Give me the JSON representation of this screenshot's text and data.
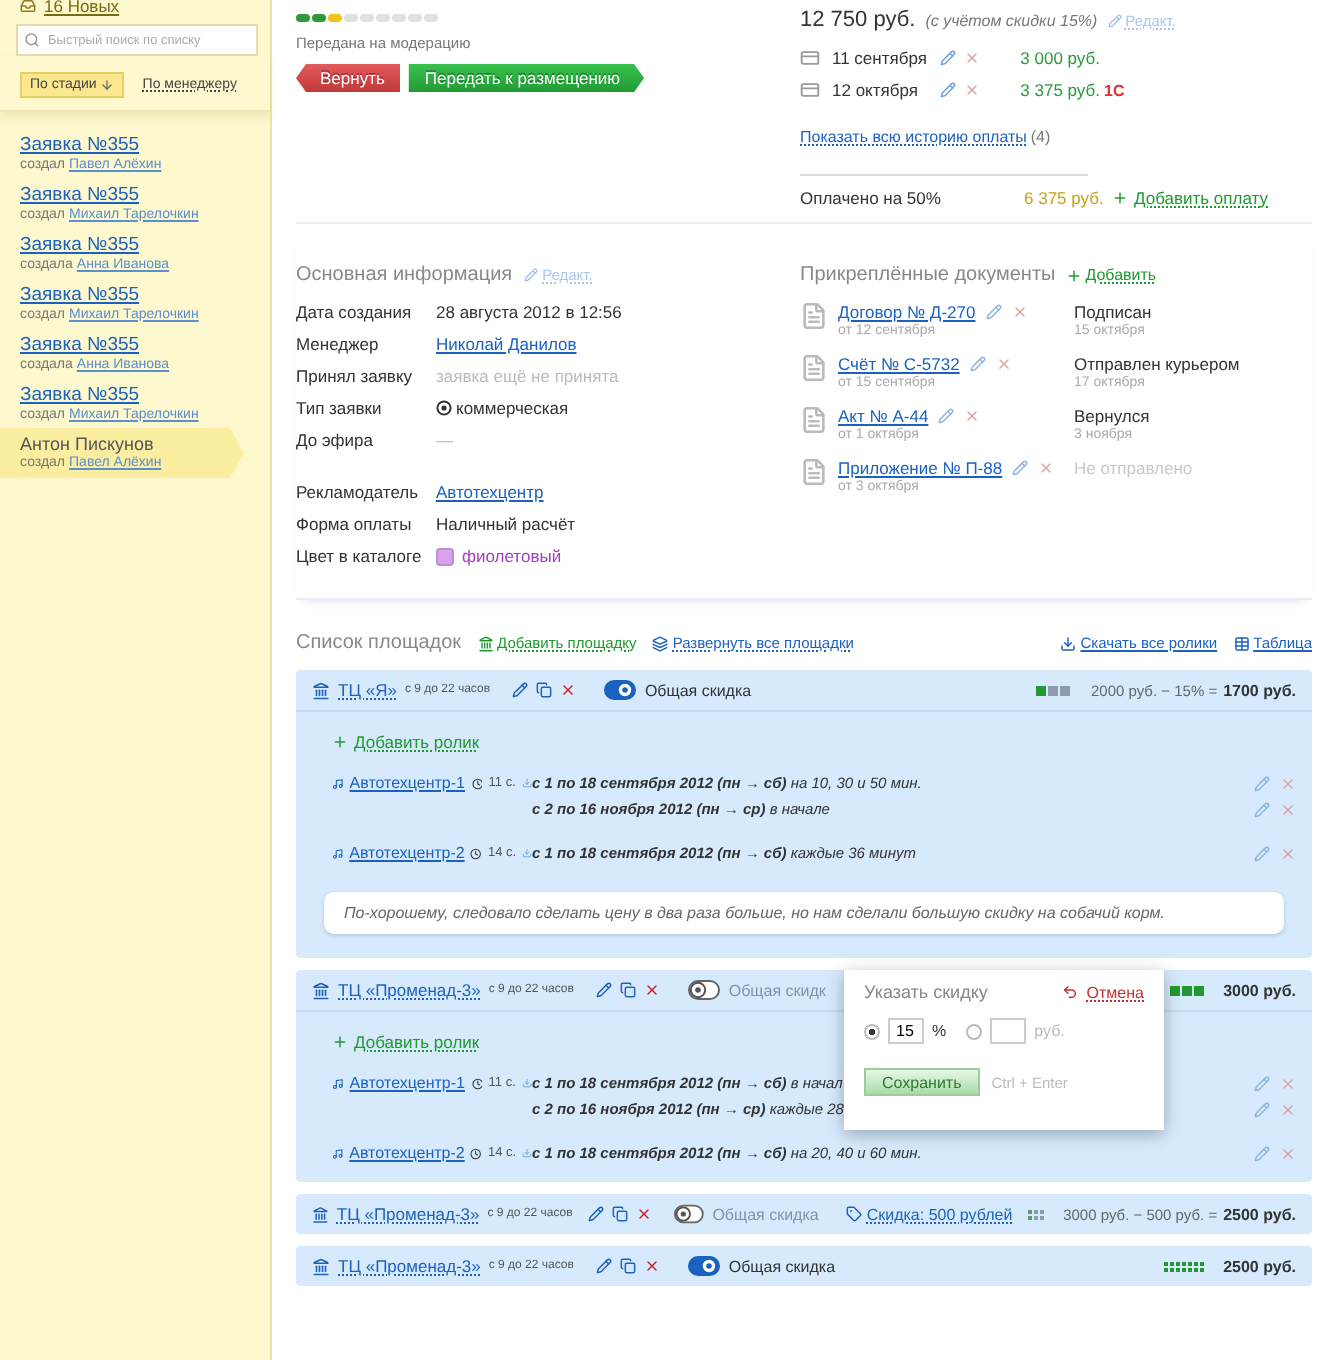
{
  "sidebar": {
    "new_link": "16 Новых",
    "search": {
      "placeholder": "Быстрый поиск по списку"
    },
    "sort_tabs": [
      {
        "label": "По стадии",
        "selected": true
      },
      {
        "label": "По менеджеру",
        "selected": false
      }
    ],
    "items": [
      {
        "title": "Заявка №355",
        "prefix": "создал",
        "author": "Павел Алёхин",
        "selected": false
      },
      {
        "title": "Заявка №355",
        "prefix": "создал",
        "author": "Михаил Тарелочкин",
        "selected": false
      },
      {
        "title": "Заявка №355",
        "prefix": "создала",
        "author": "Анна Иванова",
        "selected": false
      },
      {
        "title": "Заявка №355",
        "prefix": "создал",
        "author": "Михаил Тарелочкин",
        "selected": false
      },
      {
        "title": "Заявка №355",
        "prefix": "создала",
        "author": "Анна Иванова",
        "selected": false
      },
      {
        "title": "Заявка №355",
        "prefix": "создал",
        "author": "Михаил Тарелочкин",
        "selected": false
      },
      {
        "title": "Антон Пискунов",
        "prefix": "создал",
        "author": "Павел Алёхин",
        "selected": true
      }
    ]
  },
  "stage": {
    "segments": [
      {
        "color": "#2f9a3c"
      },
      {
        "color": "#2f9a3c"
      },
      {
        "color": "#f2c318"
      },
      {
        "color": "#e0e0e0"
      },
      {
        "color": "#e0e0e0"
      },
      {
        "color": "#e0e0e0"
      },
      {
        "color": "#e0e0e0"
      },
      {
        "color": "#e0e0e0"
      },
      {
        "color": "#e0e0e0"
      }
    ],
    "label": "Передана на модерацию",
    "buttons": [
      {
        "label": "Вернуть",
        "kind": "back"
      },
      {
        "label": "Передать к размещению",
        "kind": "forward"
      }
    ]
  },
  "payment": {
    "total": "12 750 руб.",
    "note": "(с учётом скидки 15%)",
    "edit": "Редакт.",
    "rows": [
      {
        "date": "11 сентября",
        "amount": "3 000 руб."
      },
      {
        "date": "12 октября",
        "amount": "3 375 руб.",
        "badge": "1С"
      }
    ],
    "history_link": "Показать всю историю оплаты",
    "history_count": "(4)",
    "paid": "Оплачено на 50%",
    "remaining": "6 375 руб.",
    "add": "Добавить оплату"
  },
  "info": {
    "title": "Основная информация",
    "edit": "Редакт.",
    "groups": [
      [
        {
          "label": "Дата создания",
          "value": "28 августа 2012 в 12:56",
          "kind": "text"
        },
        {
          "label": "Менеджер",
          "value": "Николай Данилов",
          "kind": "link"
        },
        {
          "label": "Принял заявку",
          "value": "заявка ещё не принята",
          "kind": "muted"
        },
        {
          "label": "Тип заявки",
          "value": "коммерческая",
          "kind": "radio"
        },
        {
          "label": "До эфира",
          "value": "—",
          "kind": "muted"
        }
      ],
      [
        {
          "label": "Рекламодатель",
          "value": "Автотехцентр",
          "kind": "link"
        },
        {
          "label": "Форма оплаты",
          "value": "Наличный расчёт",
          "kind": "text"
        },
        {
          "label": "Цвет в каталоге",
          "value": "фиолетовый",
          "kind": "color",
          "color": "#d9a3ea"
        }
      ]
    ]
  },
  "documents": {
    "title": "Прикреплённые документы",
    "add": "Добавить",
    "items": [
      {
        "name": "Договор  № Д-270",
        "date": "от 12 сентября",
        "status": "Подписан",
        "status_date": "15 октября",
        "sent": true
      },
      {
        "name": "Счёт № С-5732",
        "date": "от 15 сентября",
        "status": "Отправлен курьером",
        "status_date": "17 октября",
        "sent": true
      },
      {
        "name": "Акт № А-44",
        "date": "от 1 октября",
        "status": "Вернулся",
        "status_date": "3 ноября",
        "sent": true
      },
      {
        "name": "Приложение № П-88",
        "date": "от 3 октября",
        "status": "Не отправлено",
        "sent": false
      }
    ]
  },
  "sites": {
    "title": "Список площадок",
    "add": "Добавить площадку",
    "expand_all": "Развернуть все площадки",
    "download_all": "Скачать все ролики",
    "table": "Таблица",
    "blocks": [
      {
        "name": "ТЦ «Я»",
        "hours": "с 9 до 22 часов",
        "discount_on": true,
        "discount_label": "Общая скидка",
        "meter": {
          "kind": "blocks",
          "cells": [
            {
              "color": "#1f9a30"
            },
            {
              "color": "#8d9cad"
            },
            {
              "color": "#8d9cad"
            }
          ]
        },
        "price_base": "2000 руб. − 15% =",
        "price_total": "1700 руб.",
        "add_clip": "Добавить ролик",
        "clips": [
          {
            "name": "Автотехцентр-1",
            "duration": "11 с.",
            "schedules": [
              {
                "period": "с 1 по 18 сентября 2012 (пн → сб)",
                "note": "на 10, 30 и 50 мин."
              },
              {
                "period": "с 2 по 16 ноября 2012 (пн → ср)",
                "note": "в начале"
              }
            ]
          },
          {
            "name": "Автотехцентр-2",
            "duration": "14 с.",
            "schedules": [
              {
                "period": "с 1 по 18 сентября 2012 (пн → сб)",
                "note": "каждые 36 минут"
              }
            ]
          }
        ],
        "comment": "По-хорошему, следовало сделать цену в два раза больше, но нам сделали большую скидку на собачий корм."
      },
      {
        "name": "ТЦ «Променад-3»",
        "hours": "с 9 до 22 часов",
        "discount_on": false,
        "discount_label": "Общая скидк",
        "meter": {
          "kind": "blocks",
          "cells": [
            {
              "color": "#1f9a30"
            },
            {
              "color": "#1f9a30"
            },
            {
              "color": "#1f9a30"
            }
          ]
        },
        "price_total": "3000 руб.",
        "add_clip": "Добавить ролик",
        "clips": [
          {
            "name": "Автотехцентр-1",
            "duration": "11 с.",
            "schedules": [
              {
                "period": "с 1 по 18 сентября 2012 (пн → сб)",
                "note": "в начал"
              },
              {
                "period": "с 2 по 16 ноября 2012 (пн → ср)",
                "note": "каждые 28"
              }
            ]
          },
          {
            "name": "Автотехцентр-2",
            "duration": "14 с.",
            "schedules": [
              {
                "period": "с 1 по 18 сентября 2012 (пн → сб)",
                "note": "на 20, 40 и 60 мин."
              }
            ]
          }
        ],
        "popover": {
          "title": "Указать скидку",
          "cancel": "Отмена",
          "options": [
            {
              "value": "15",
              "unit": "%",
              "selected": true
            },
            {
              "unit": "руб.",
              "selected": false
            }
          ],
          "save": "Сохранить",
          "hint": "Ctrl + Enter"
        }
      },
      {
        "name": "ТЦ «Променад-3»",
        "hours": "с 9 до 22 часов",
        "discount_on": false,
        "discount_label": "Общая скидка",
        "discount_tag": "Скидка: 500 рублей",
        "meter": {
          "kind": "grid",
          "cells": [
            {
              "color": "#5f9a6a"
            },
            {
              "color": "#8d9cad"
            },
            {
              "color": "#8d9cad"
            },
            {
              "color": "#5f9a6a"
            },
            {
              "color": "#8d9cad"
            },
            {
              "color": "#8d9cad"
            }
          ]
        },
        "price_base": "3000 руб. − 500 руб. =",
        "price_total": "2500 руб."
      },
      {
        "name": "ТЦ «Променад-3»",
        "hours": "с 9 до 22 часов",
        "discount_on": true,
        "discount_label": "Общая скидка",
        "meter": {
          "kind": "strip",
          "cells": [
            {
              "color": "#1f9a30"
            },
            {
              "color": "#1f9a30"
            },
            {
              "color": "#1f9a30"
            },
            {
              "color": "#1f9a30"
            },
            {
              "color": "#1f9a30"
            },
            {
              "color": "#1f9a30"
            },
            {
              "color": "#1f9a30"
            },
            {
              "color": "#1f9a30"
            },
            {
              "color": "#1f9a30"
            },
            {
              "color": "#1f9a30"
            },
            {
              "color": "#1f9a30"
            },
            {
              "color": "#1f9a30"
            },
            {
              "color": "#1f9a30"
            },
            {
              "color": "#1f9a30"
            }
          ]
        },
        "price_total": "2500 руб."
      }
    ]
  }
}
